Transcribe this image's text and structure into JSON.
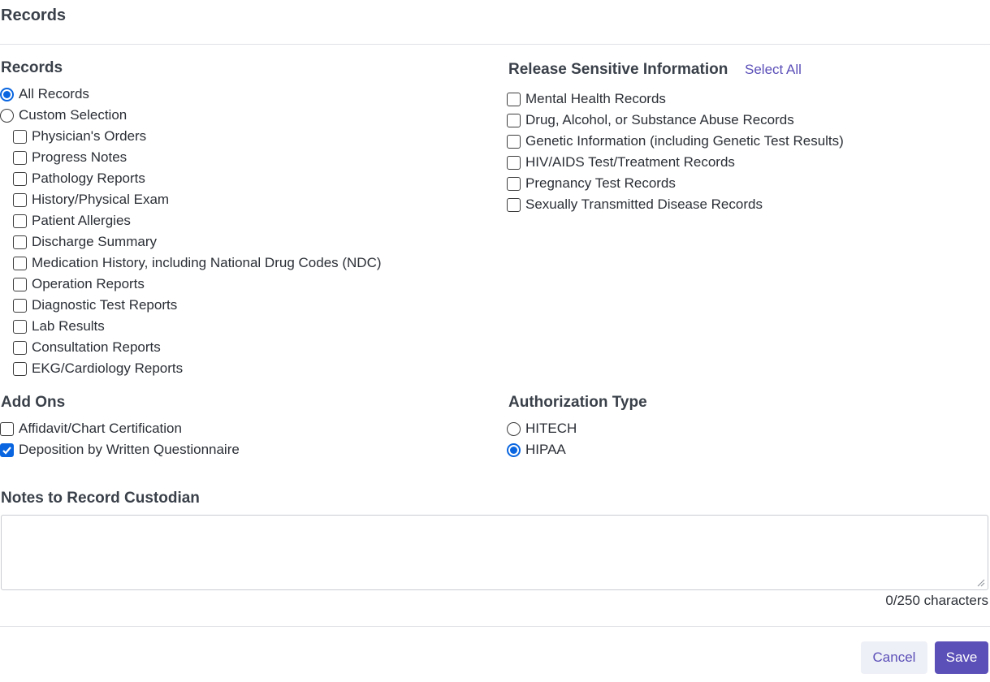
{
  "header": {
    "title": "Records"
  },
  "records": {
    "title": "Records",
    "options": [
      {
        "label": "All Records",
        "selected": true
      },
      {
        "label": "Custom Selection",
        "selected": false
      }
    ],
    "custom_items": [
      {
        "label": "Physician's Orders",
        "checked": false
      },
      {
        "label": "Progress Notes",
        "checked": false
      },
      {
        "label": "Pathology Reports",
        "checked": false
      },
      {
        "label": "History/Physical Exam",
        "checked": false
      },
      {
        "label": "Patient Allergies",
        "checked": false
      },
      {
        "label": "Discharge Summary",
        "checked": false
      },
      {
        "label": "Medication History, including National Drug Codes (NDC)",
        "checked": false
      },
      {
        "label": "Operation Reports",
        "checked": false
      },
      {
        "label": "Diagnostic Test Reports",
        "checked": false
      },
      {
        "label": "Lab Results",
        "checked": false
      },
      {
        "label": "Consultation Reports",
        "checked": false
      },
      {
        "label": "EKG/Cardiology Reports",
        "checked": false
      }
    ]
  },
  "sensitive": {
    "title": "Release Sensitive Information",
    "select_all_label": "Select All",
    "items": [
      {
        "label": "Mental Health Records",
        "checked": false
      },
      {
        "label": "Drug, Alcohol, or Substance Abuse Records",
        "checked": false
      },
      {
        "label": "Genetic Information (including Genetic Test Results)",
        "checked": false
      },
      {
        "label": "HIV/AIDS Test/Treatment Records",
        "checked": false
      },
      {
        "label": "Pregnancy Test Records",
        "checked": false
      },
      {
        "label": "Sexually Transmitted Disease Records",
        "checked": false
      }
    ]
  },
  "addons": {
    "title": "Add Ons",
    "items": [
      {
        "label": "Affidavit/Chart Certification",
        "checked": false
      },
      {
        "label": "Deposition by Written Questionnaire",
        "checked": true
      }
    ]
  },
  "authorization": {
    "title": "Authorization Type",
    "options": [
      {
        "label": "HITECH",
        "selected": false
      },
      {
        "label": "HIPAA",
        "selected": true
      }
    ]
  },
  "notes": {
    "title": "Notes to Record Custodian",
    "value": "",
    "char_count": "0/250 characters"
  },
  "footer": {
    "cancel_label": "Cancel",
    "save_label": "Save"
  },
  "colors": {
    "accent": "#5b4fb8",
    "control_blue": "#0a66e0",
    "cancel_bg": "#eef0f7"
  }
}
